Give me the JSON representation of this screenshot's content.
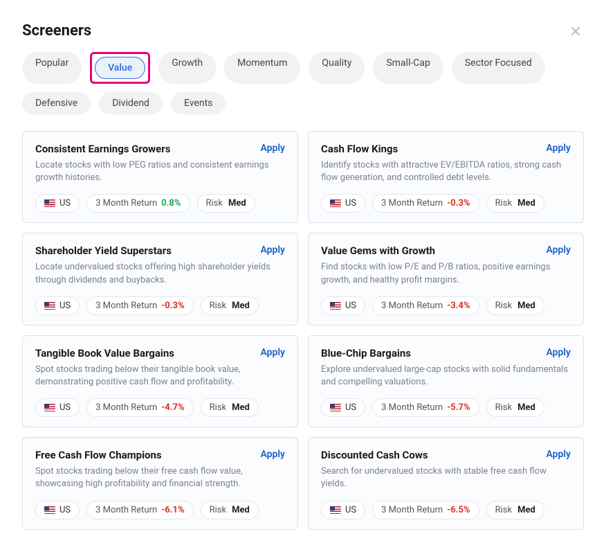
{
  "title": "Screeners",
  "apply_label": "Apply",
  "return_label": "3 Month Return",
  "risk_label": "Risk",
  "risk_value": "Med",
  "region_label": "US",
  "tabs": [
    {
      "label": "Popular",
      "active": false
    },
    {
      "label": "Value",
      "active": true
    },
    {
      "label": "Growth",
      "active": false
    },
    {
      "label": "Momentum",
      "active": false
    },
    {
      "label": "Quality",
      "active": false
    },
    {
      "label": "Small-Cap",
      "active": false
    },
    {
      "label": "Sector Focused",
      "active": false
    },
    {
      "label": "Defensive",
      "active": false
    },
    {
      "label": "Dividend",
      "active": false
    },
    {
      "label": "Events",
      "active": false
    }
  ],
  "cards": [
    {
      "title": "Consistent Earnings Growers",
      "desc": "Locate stocks with low PEG ratios and consistent earnings growth histories.",
      "return": "0.8%",
      "return_dir": "pos"
    },
    {
      "title": "Cash Flow Kings",
      "desc": "Identify stocks with attractive EV/EBITDA ratios, strong cash flow generation, and controlled debt levels.",
      "return": "-0.3%",
      "return_dir": "neg"
    },
    {
      "title": "Shareholder Yield Superstars",
      "desc": "Locate undervalued stocks offering high shareholder yields through dividends and buybacks.",
      "return": "-0.3%",
      "return_dir": "neg"
    },
    {
      "title": "Value Gems with Growth",
      "desc": "Find stocks with low P/E and P/B ratios, positive earnings growth, and healthy profit margins.",
      "return": "-3.4%",
      "return_dir": "neg"
    },
    {
      "title": "Tangible Book Value Bargains",
      "desc": "Spot stocks trading below their tangible book value, demonstrating positive cash flow and profitability.",
      "return": "-4.7%",
      "return_dir": "neg"
    },
    {
      "title": "Blue-Chip Bargains",
      "desc": "Explore undervalued large-cap stocks with solid fundamentals and compelling valuations.",
      "return": "-5.7%",
      "return_dir": "neg"
    },
    {
      "title": "Free Cash Flow Champions",
      "desc": "Spot stocks trading below their free cash flow value, showcasing high profitability and financial strength.",
      "return": "-6.1%",
      "return_dir": "neg"
    },
    {
      "title": "Discounted Cash Cows",
      "desc": "Search for undervalued stocks with stable free cash flow yields.",
      "return": "-6.5%",
      "return_dir": "neg"
    }
  ]
}
